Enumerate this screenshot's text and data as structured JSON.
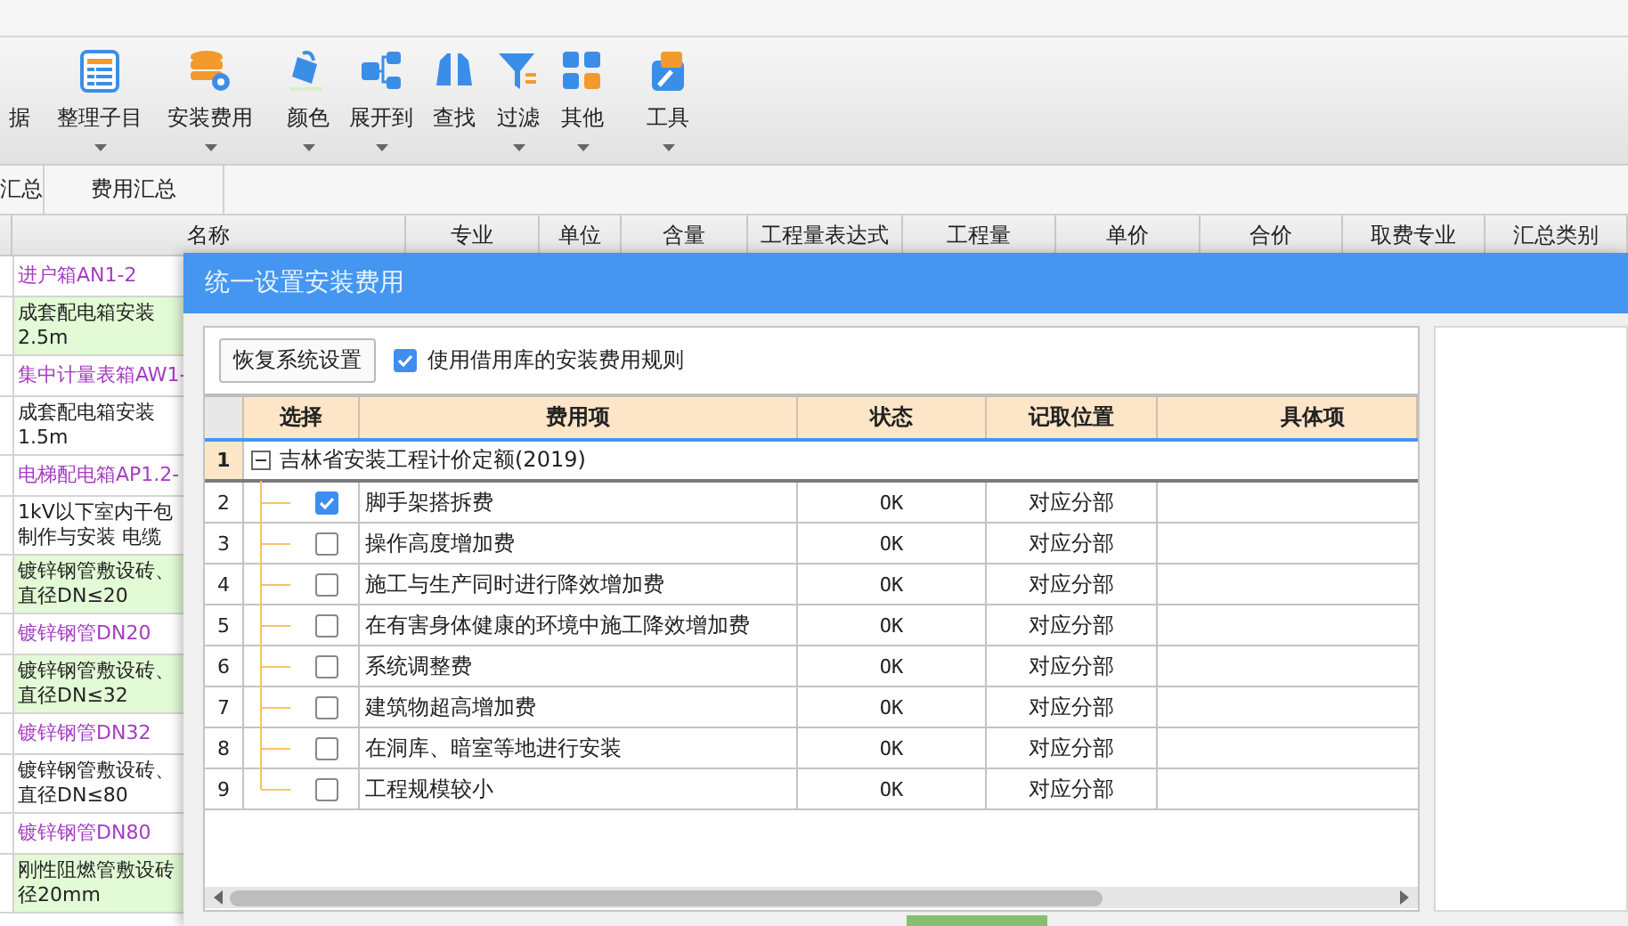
{
  "toolbar": [
    {
      "label": "据",
      "dropdown": false
    },
    {
      "label": "整理子目",
      "dropdown": true
    },
    {
      "label": "安装费用",
      "dropdown": true
    },
    {
      "label": "颜色",
      "dropdown": true
    },
    {
      "label": "展开到",
      "dropdown": true
    },
    {
      "label": "查找",
      "dropdown": false
    },
    {
      "label": "过滤",
      "dropdown": true
    },
    {
      "label": "其他",
      "dropdown": true
    },
    {
      "label": "工具",
      "dropdown": true
    }
  ],
  "tabs": [
    {
      "label": "汇总"
    },
    {
      "label": "费用汇总"
    }
  ],
  "table": {
    "columns": [
      "名称",
      "专业",
      "单位",
      "含量",
      "工程量表达式",
      "工程量",
      "单价",
      "合价",
      "取费专业",
      "汇总类别"
    ],
    "rows": [
      {
        "kind": "group",
        "lines": [
          "进户箱AN1-2"
        ]
      },
      {
        "kind": "entry",
        "shaded": true,
        "lines": [
          "成套配电箱安装",
          "2.5m"
        ]
      },
      {
        "kind": "group",
        "lines": [
          "集中计量表箱AW1-"
        ]
      },
      {
        "kind": "entry",
        "shaded": false,
        "lines": [
          "成套配电箱安装",
          "1.5m"
        ]
      },
      {
        "kind": "group",
        "lines": [
          "电梯配电箱AP1.2-"
        ]
      },
      {
        "kind": "entry",
        "shaded": false,
        "lines": [
          "1kV以下室内干包",
          "制作与安装 电缆"
        ]
      },
      {
        "kind": "entry",
        "shaded": true,
        "lines": [
          "镀锌钢管敷设砖、",
          "直径DN≤20"
        ]
      },
      {
        "kind": "group",
        "lines": [
          "镀锌钢管DN20"
        ]
      },
      {
        "kind": "entry",
        "shaded": true,
        "lines": [
          "镀锌钢管敷设砖、",
          "直径DN≤32"
        ]
      },
      {
        "kind": "group",
        "lines": [
          "镀锌钢管DN32"
        ]
      },
      {
        "kind": "entry",
        "shaded": false,
        "lines": [
          "镀锌钢管敷设砖、",
          "直径DN≤80"
        ]
      },
      {
        "kind": "group",
        "lines": [
          "镀锌钢管DN80"
        ]
      },
      {
        "kind": "entry",
        "shaded": true,
        "lines": [
          "刚性阻燃管敷设砖",
          "径20mm"
        ]
      }
    ]
  },
  "dialog": {
    "title": "统一设置安装费用",
    "reset_button": "恢复系统设置",
    "use_library_rules": {
      "label": "使用借用库的安装费用规则",
      "checked": true
    },
    "grid": {
      "columns": [
        "选择",
        "费用项",
        "状态",
        "记取位置",
        "具体项"
      ],
      "group": {
        "number": "1",
        "label": "吉林省安装工程计价定额(2019)",
        "expanded": true
      },
      "rows": [
        {
          "number": "2",
          "checked": true,
          "name": "脚手架搭拆费",
          "status": "OK",
          "position": "对应分部"
        },
        {
          "number": "3",
          "checked": false,
          "name": "操作高度增加费",
          "status": "OK",
          "position": "对应分部"
        },
        {
          "number": "4",
          "checked": false,
          "name": "施工与生产同时进行降效增加费",
          "status": "OK",
          "position": "对应分部"
        },
        {
          "number": "5",
          "checked": false,
          "name": "在有害身体健康的环境中施工降效增加费",
          "status": "OK",
          "position": "对应分部"
        },
        {
          "number": "6",
          "checked": false,
          "name": "系统调整费",
          "status": "OK",
          "position": "对应分部"
        },
        {
          "number": "7",
          "checked": false,
          "name": "建筑物超高增加费",
          "status": "OK",
          "position": "对应分部"
        },
        {
          "number": "8",
          "checked": false,
          "name": "在洞库、暗室等地进行安装",
          "status": "OK",
          "position": "对应分部"
        },
        {
          "number": "9",
          "checked": false,
          "name": "工程规模较小",
          "status": "OK",
          "position": "对应分部"
        }
      ]
    }
  }
}
